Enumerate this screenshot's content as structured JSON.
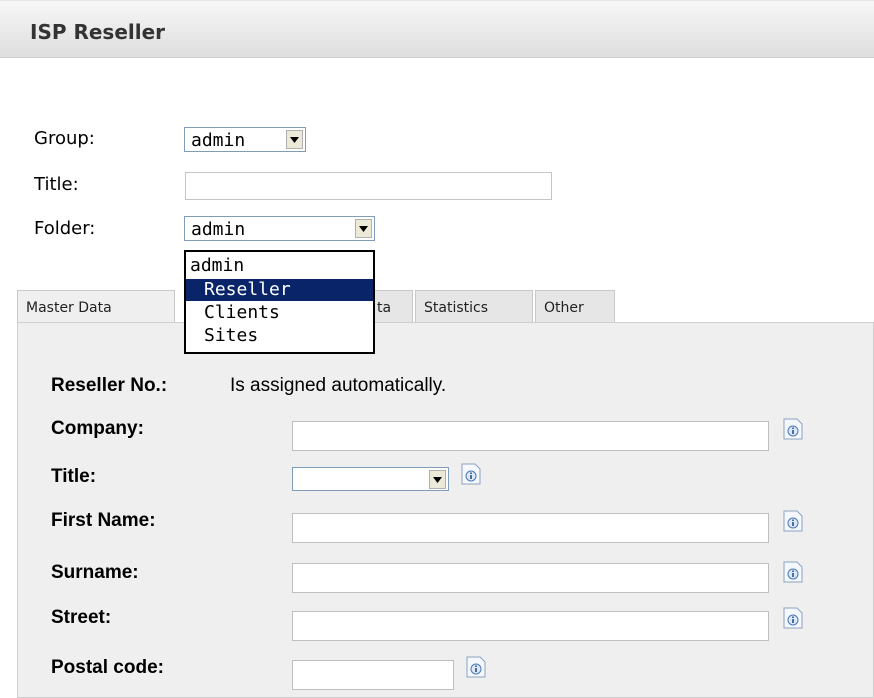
{
  "header": {
    "title": "ISP Reseller"
  },
  "form": {
    "group": {
      "label": "Group:",
      "value": "admin"
    },
    "title": {
      "label": "Title:",
      "value": ""
    },
    "folder": {
      "label": "Folder:",
      "value": "admin"
    }
  },
  "folder_dropdown": {
    "options": [
      "admin",
      "Reseller",
      "Clients",
      "Sites"
    ],
    "selected": "Reseller"
  },
  "tabs": [
    {
      "label": "Master Data"
    },
    {
      "label": "ta"
    },
    {
      "label": "Statistics"
    },
    {
      "label": "Other"
    }
  ],
  "fields": {
    "reseller_no": {
      "label": "Reseller No.:",
      "value": "Is assigned automatically."
    },
    "company": {
      "label": "Company:",
      "value": ""
    },
    "title": {
      "label": "Title:",
      "value": ""
    },
    "first_name": {
      "label": "First Name:",
      "value": ""
    },
    "surname": {
      "label": "Surname:",
      "value": ""
    },
    "street": {
      "label": "Street:",
      "value": ""
    },
    "postal_code": {
      "label": "Postal code:",
      "value": ""
    }
  },
  "icons": {
    "dropdown_arrow": "chevron-down-icon",
    "info": "info-icon"
  },
  "colors": {
    "selection": "#0a246a",
    "panel": "#efefef",
    "header": "#dedede"
  }
}
